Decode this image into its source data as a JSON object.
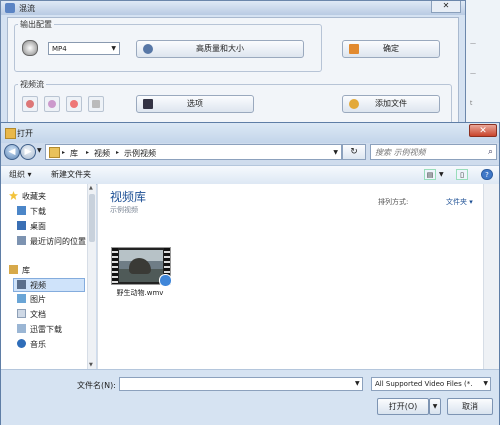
{
  "bg_app": {
    "title": "混流",
    "close_label": "✕",
    "output_group_label": "输出配置",
    "format_value": "MP4",
    "quality_button": "高质量和大小",
    "confirm_button": "确定",
    "video_group_label": "视频流",
    "options_button": "选项",
    "add_file_button": "添加文件",
    "right_edge_texts": [
      "—",
      "—",
      "t"
    ]
  },
  "dialog": {
    "title": "打开",
    "close_label": "✕",
    "nav_back_icon": "back-arrow-icon",
    "nav_forward_icon": "forward-arrow-icon",
    "breadcrumb": [
      "库",
      "视频",
      "示例视频"
    ],
    "refresh_icon": "refresh-icon",
    "search_placeholder": "搜索 示例视频",
    "toolbar": {
      "organize": "组织 ▾",
      "new_folder": "新建文件夹"
    },
    "nav": {
      "favorites": "收藏夹",
      "downloads": "下载",
      "desktop": "桌面",
      "recent": "最近访问的位置",
      "libraries": "库",
      "videos": "视频",
      "pictures": "图片",
      "documents": "文档",
      "thunder": "迅雷下载",
      "music": "音乐"
    },
    "library": {
      "title": "视频库",
      "subtitle": "示例视频",
      "arrange_label": "排列方式:",
      "arrange_value": "文件夹 ▾"
    },
    "file": {
      "name": "野生动物.wmv"
    },
    "bottom": {
      "filename_label": "文件名(N):",
      "filename_value": "",
      "filter_value": "All Supported Video Files (*.",
      "open_button": "打开(O)",
      "cancel_button": "取消"
    }
  }
}
